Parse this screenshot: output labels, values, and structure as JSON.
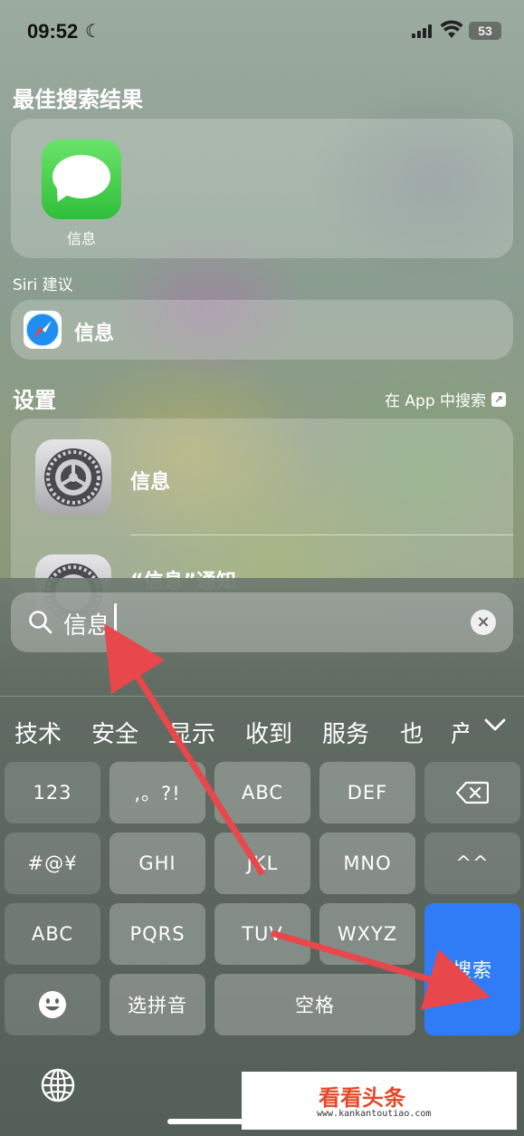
{
  "status_bar": {
    "time": "09:52",
    "battery": "53"
  },
  "best_result": {
    "title": "最佳搜索结果",
    "app_label": "信息"
  },
  "siri": {
    "label": "Siri 建议",
    "item_label": "信息"
  },
  "settings": {
    "title": "设置",
    "in_app_search": "在 App 中搜索",
    "items": [
      {
        "label": "信息"
      },
      {
        "label": "“信息”通知"
      }
    ]
  },
  "search": {
    "value": "信息"
  },
  "candidates": [
    "技术",
    "安全",
    "显示",
    "收到",
    "服务",
    "也",
    "产"
  ],
  "keyboard": {
    "row1": [
      "123",
      ",。?!",
      "ABC",
      "DEF"
    ],
    "row2": [
      "#@¥",
      "GHI",
      "JKL",
      "MNO",
      "^^"
    ],
    "row3": [
      "ABC",
      "PQRS",
      "TUV",
      "WXYZ"
    ],
    "row4": [
      "选拼音",
      "空格"
    ],
    "search_key": "搜索"
  },
  "watermark": {
    "main": "看看头条",
    "sub": "www.kankantoutiao.com"
  },
  "colors": {
    "accent_blue": "#2f7cf6",
    "annotation_red": "#e8474c"
  }
}
